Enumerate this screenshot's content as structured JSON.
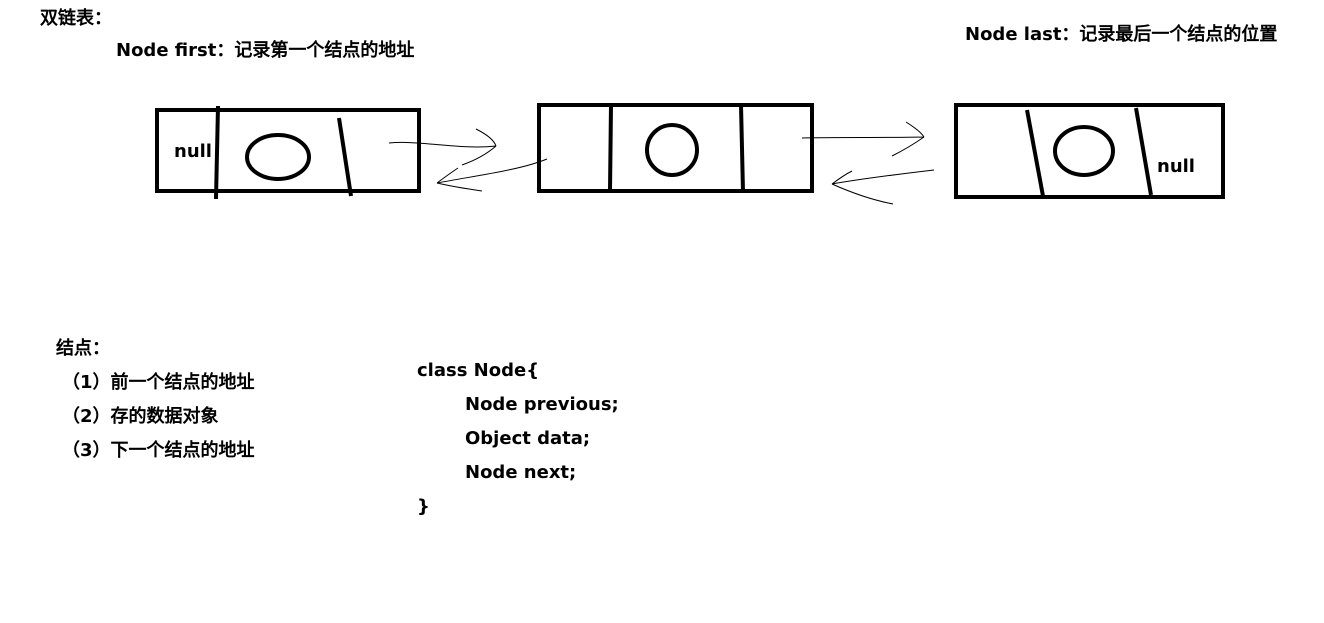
{
  "title": "双链表：",
  "first_label": "Node first：记录第一个结点的地址",
  "last_label": "Node last：记录最后一个结点的位置",
  "nodes": [
    {
      "prev_text": "null",
      "next_text": ""
    },
    {
      "prev_text": "",
      "next_text": ""
    },
    {
      "prev_text": "",
      "next_text": "null"
    }
  ],
  "node_description": {
    "heading": "结点：",
    "items": [
      "（1）前一个结点的地址",
      "（2）存的数据对象",
      "（3）下一个结点的地址"
    ]
  },
  "code": {
    "lines": [
      "class Node{",
      "Node previous;",
      "Object data;",
      "Node next;",
      "}"
    ]
  }
}
